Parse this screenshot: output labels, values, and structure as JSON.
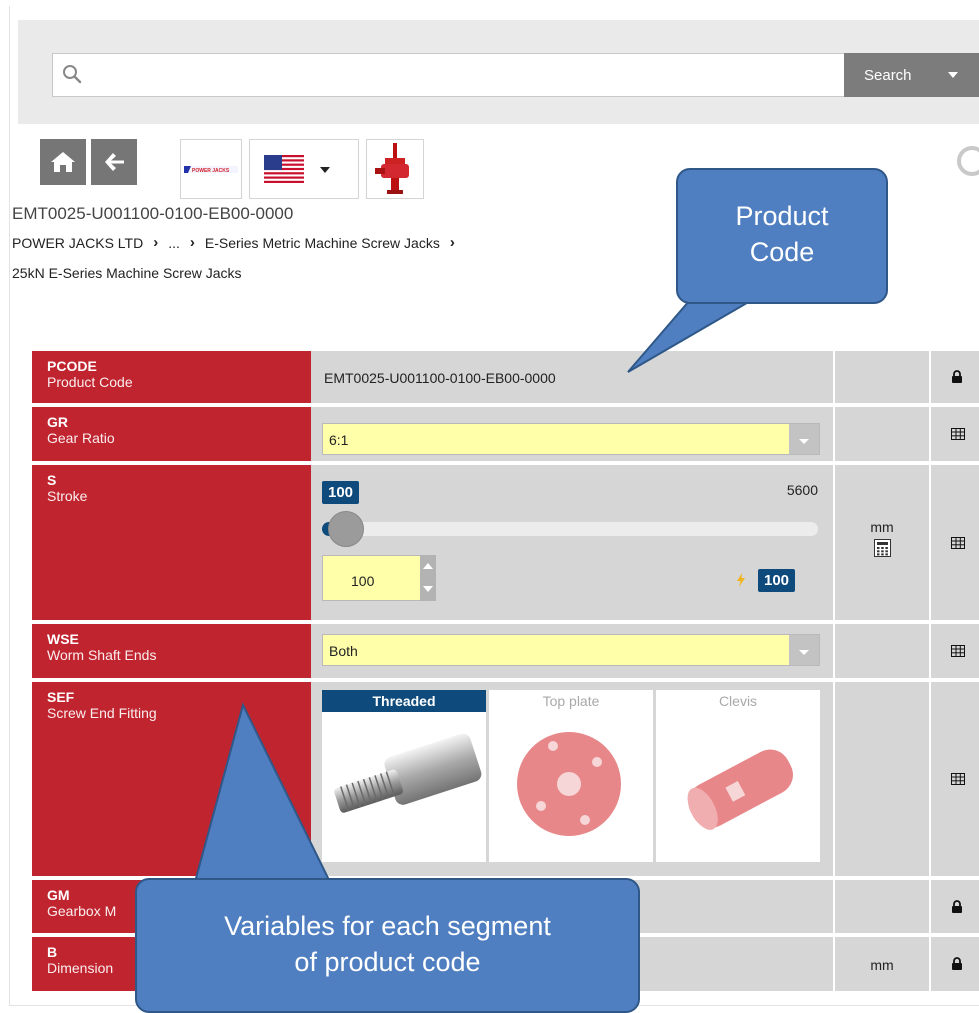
{
  "search": {
    "placeholder": "",
    "button_label": "Search"
  },
  "toolbar": {
    "home_icon": "home-icon",
    "back_icon": "arrow-left-icon",
    "brand_logo_text": "POWER JACKS",
    "flag_icon": "us-flag-icon"
  },
  "product_code_line": "EMT0025-U001100-0100-EB00-0000",
  "breadcrumb": {
    "items": [
      "POWER JACKS LTD",
      "...",
      "E-Series Metric Machine Screw Jacks"
    ],
    "second_line": "25kN E-Series Machine Screw Jacks"
  },
  "table": {
    "pcode": {
      "key": "PCODE",
      "desc": "Product Code",
      "value": "EMT0025-U001100-0100-EB00-0000"
    },
    "gr": {
      "key": "GR",
      "desc": "Gear Ratio",
      "value": "6:1"
    },
    "s": {
      "key": "S",
      "desc": "Stroke",
      "min_badge": "100",
      "max_label": "5600",
      "input_value": "100",
      "current_badge": "100",
      "unit": "mm",
      "slider_fraction": 0.0
    },
    "wse": {
      "key": "WSE",
      "desc": "Worm Shaft Ends",
      "value": "Both"
    },
    "sef": {
      "key": "SEF",
      "desc": "Screw End Fitting",
      "options": [
        "Threaded",
        "Top plate",
        "Clevis"
      ],
      "selected": "Threaded"
    },
    "gm": {
      "key": "GM",
      "desc": "Gearbox M"
    },
    "b": {
      "key": "B",
      "desc": "Dimension",
      "unit": "mm"
    }
  },
  "callouts": {
    "product_code": [
      "Product",
      "Code"
    ],
    "variables": [
      "Variables for each segment",
      "of product code"
    ]
  },
  "colors": {
    "label_red": "#c0242f",
    "accent_blue": "#0e4a7c",
    "input_yellow": "#ffffaa",
    "callout_blue": "#4f7fc1"
  }
}
